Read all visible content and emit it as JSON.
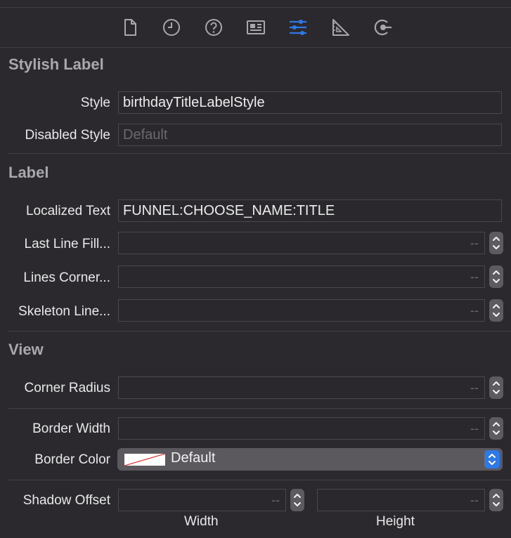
{
  "toolbar": {
    "icons": [
      "file-icon",
      "history-icon",
      "help-icon",
      "identity-icon",
      "attributes-icon",
      "size-icon",
      "connections-icon"
    ],
    "accent": "#2f78e8"
  },
  "stylish_label": {
    "title": "Stylish Label",
    "style_label": "Style",
    "style_value": "birthdayTitleLabelStyle",
    "disabled_style_label": "Disabled Style",
    "disabled_style_placeholder": "Default"
  },
  "label_section": {
    "title": "Label",
    "localized_text_label": "Localized Text",
    "localized_text_value": "FUNNEL:CHOOSE_NAME:TITLE",
    "last_line_fill_label": "Last Line Fill...",
    "lines_corner_label": "Lines Corner...",
    "skeleton_line_label": "Skeleton Line...",
    "empty_value": "--"
  },
  "view_section": {
    "title": "View",
    "corner_radius_label": "Corner Radius",
    "border_width_label": "Border Width",
    "border_color_label": "Border Color",
    "border_color_value": "Default",
    "shadow_offset_label": "Shadow Offset",
    "width_label": "Width",
    "height_label": "Height",
    "empty_value": "--"
  }
}
